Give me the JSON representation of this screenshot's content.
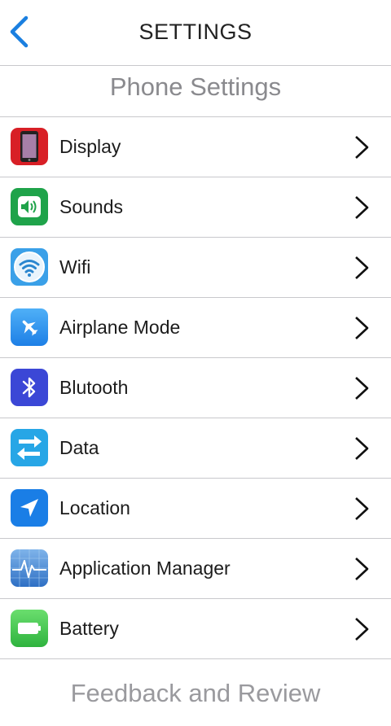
{
  "header": {
    "title": "SETTINGS",
    "back_icon": "chevron-left-icon",
    "accent_color": "#1a7fe0"
  },
  "sections": {
    "phone_settings": "Phone Settings",
    "feedback": "Feedback and Review"
  },
  "items": [
    {
      "label": "Display",
      "icon": "phone-display-icon",
      "color": "#d81f26"
    },
    {
      "label": "Sounds",
      "icon": "speaker-icon",
      "color": "#1fa34a"
    },
    {
      "label": "Wifi",
      "icon": "wifi-icon",
      "color": "#3aa0e8"
    },
    {
      "label": "Airplane Mode",
      "icon": "airplane-icon",
      "color": "#2b8ff0"
    },
    {
      "label": "Blutooth",
      "icon": "bluetooth-icon",
      "color": "#3b47d6"
    },
    {
      "label": "Data",
      "icon": "data-transfer-icon",
      "color": "#27a6e6"
    },
    {
      "label": "Location",
      "icon": "location-arrow-icon",
      "color": "#1a7ee6"
    },
    {
      "label": "Application Manager",
      "icon": "activity-monitor-icon",
      "color": "#3b7fd1"
    },
    {
      "label": "Battery",
      "icon": "battery-icon",
      "color": "#3cc44a"
    }
  ]
}
